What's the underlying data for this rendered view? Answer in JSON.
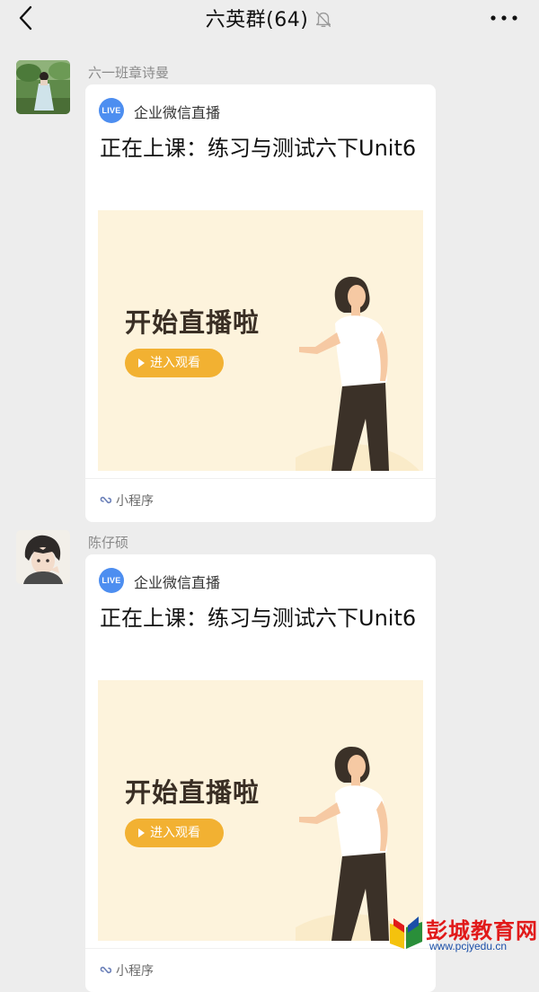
{
  "header": {
    "title": "六英群(64)",
    "back_icon": "chevron-left-icon",
    "mute_icon": "bell-muted-icon",
    "more_icon": "more-dots-icon"
  },
  "messages": [
    {
      "sender": "六一班章诗曼",
      "card": {
        "live_badge": "LIVE",
        "app_name": "企业微信直播",
        "title": "正在上课：练习与测试六下Unit6",
        "banner_headline": "开始直播啦",
        "enter_button": "进入观看",
        "footer_label": "小程序"
      }
    },
    {
      "sender": "陈仔硕",
      "card": {
        "live_badge": "LIVE",
        "app_name": "企业微信直播",
        "title": "正在上课：练习与测试六下Unit6",
        "banner_headline": "开始直播啦",
        "enter_button": "进入观看",
        "footer_label": "小程序"
      }
    }
  ],
  "watermark": {
    "name": "彭城教育网",
    "url": "www.pcjyedu.cn"
  },
  "colors": {
    "background": "#ededed",
    "live_blue": "#4d8ef0",
    "banner_bg": "#fdf3dc",
    "button_orange": "#f2b132"
  }
}
